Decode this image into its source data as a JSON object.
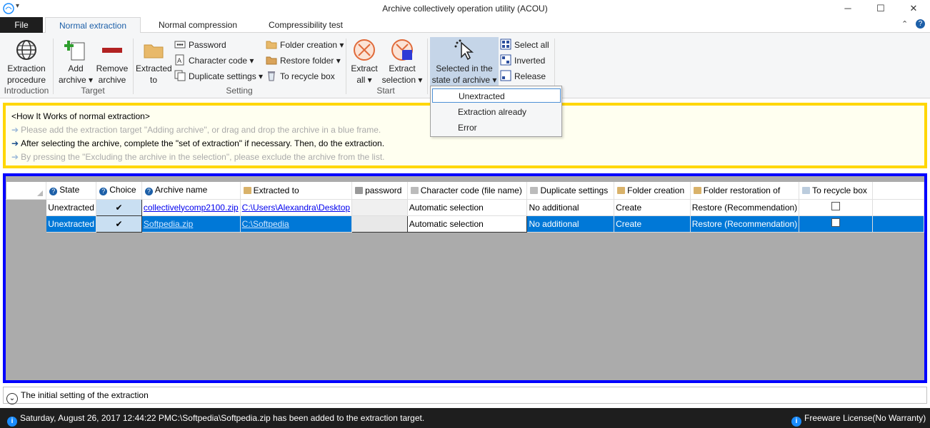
{
  "window": {
    "title": "Archive collectively operation utility (ACOU)",
    "minimize": "─",
    "maximize": "☐",
    "close": "✕"
  },
  "tabs": {
    "file": "File",
    "items": [
      "Normal extraction",
      "Normal compression",
      "Compressibility test"
    ]
  },
  "ribbon": {
    "introduction": {
      "button": "Extraction procedure",
      "group": "Introduction"
    },
    "target": {
      "add": "Add archive",
      "remove": "Remove archive",
      "group": "Target"
    },
    "setting": {
      "extracted_to": "Extracted to",
      "password": "Password",
      "character_code": "Character code",
      "duplicate_settings": "Duplicate settings",
      "folder_creation": "Folder creation",
      "restore_folder": "Restore folder",
      "to_recycle_box": "To recycle box",
      "group": "Setting"
    },
    "start": {
      "extract_all": "Extract all",
      "extract_selection": "Extract selection",
      "group": "Start"
    },
    "selection": {
      "selected_state": "Selected in the state of archive",
      "select_all": "Select all",
      "inverted": "Inverted",
      "release": "Release"
    }
  },
  "dropdown": {
    "items": [
      "Unextracted",
      "Extraction already",
      "Error"
    ]
  },
  "howto": {
    "title": "<How It Works of normal extraction>",
    "steps": [
      "Please add the extraction target \"Adding archive\", or drag and drop the archive in a blue frame.",
      "After selecting the archive, complete the \"set of extraction\" if necessary. Then, do the extraction.",
      "By pressing the \"Excluding the archive in the selection\", please exclude the archive from the list."
    ]
  },
  "grid": {
    "headers": [
      "State",
      "Choice",
      "Archive name",
      "Extracted to",
      "password",
      "Character code (file name)",
      "Duplicate settings",
      "Folder creation",
      "Folder restoration of",
      "To recycle box"
    ],
    "rows": [
      {
        "state": "Unextracted",
        "choice": "✔",
        "archive": "collectivelycomp2100.zip",
        "extracted_to": "C:\\Users\\Alexandra\\Desktop",
        "password": "",
        "charcode": "Automatic selection",
        "duplicate": "No additional",
        "folder_creation": "Create",
        "restoration": "Restore (Recommendation)"
      },
      {
        "state": "Unextracted",
        "choice": "✔",
        "archive": "Softpedia.zip",
        "extracted_to": "C:\\Softpedia",
        "password": "",
        "charcode": "Automatic selection",
        "duplicate": "No additional",
        "folder_creation": "Create",
        "restoration": "Restore (Recommendation)"
      }
    ]
  },
  "initial_setting": "The initial setting of the extraction",
  "status": {
    "message": "Saturday, August 26, 2017 12:44:22 PMC:\\Softpedia\\Softpedia.zip has been added to the extraction target.",
    "license": "Freeware License(No Warranty)"
  },
  "colors": {
    "how_frame": "#ffd700",
    "grid_frame": "#0000ff",
    "selected_row": "#0078d7"
  }
}
